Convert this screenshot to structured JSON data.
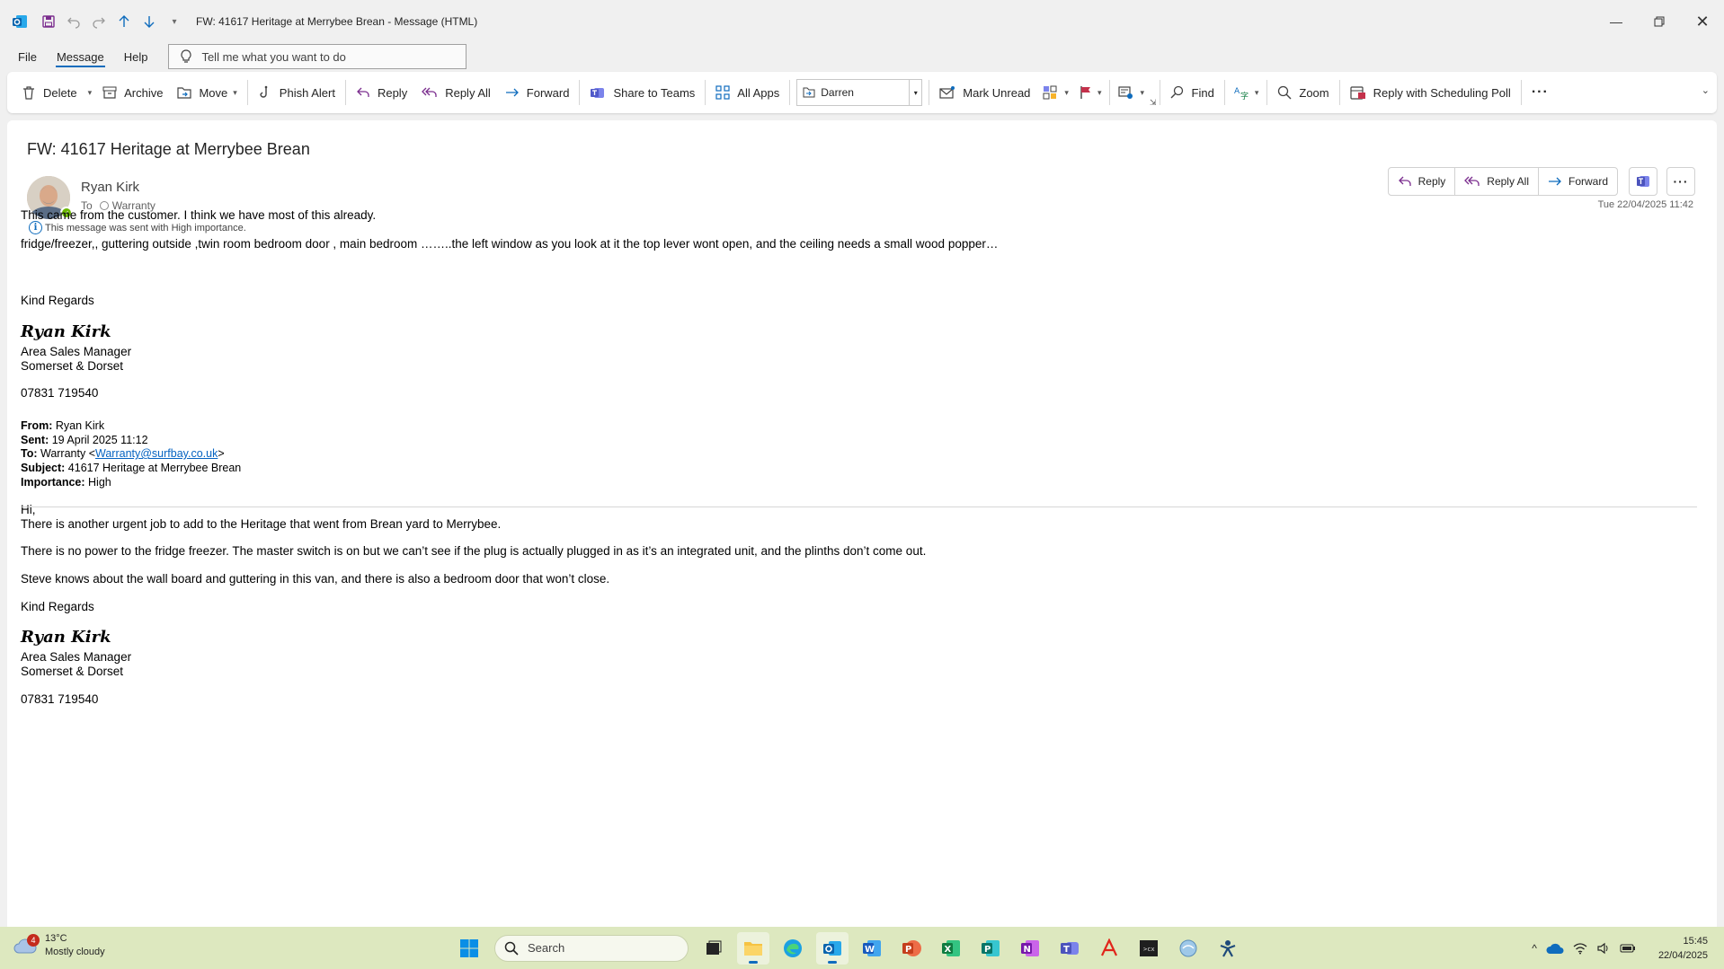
{
  "window": {
    "title": "FW: 41617 Heritage at Merrybee Brean  -  Message (HTML)"
  },
  "menu": {
    "tabs": [
      "File",
      "Message",
      "Help"
    ],
    "active_tab": "Message",
    "tell_me_placeholder": "Tell me what you want to do"
  },
  "ribbon": {
    "delete": "Delete",
    "archive": "Archive",
    "move": "Move",
    "phish_alert": "Phish Alert",
    "reply": "Reply",
    "reply_all": "Reply All",
    "forward": "Forward",
    "share_to_teams": "Share to Teams",
    "all_apps": "All Apps",
    "quick_step_value": "Darren",
    "mark_unread": "Mark Unread",
    "find": "Find",
    "zoom": "Zoom",
    "reply_scheduling_poll": "Reply with Scheduling Poll"
  },
  "message": {
    "subject": "FW: 41617 Heritage at Merrybee Brean",
    "sender": "Ryan Kirk",
    "to_label": "To",
    "to": "Warranty",
    "importance_notice": "This message was sent with High importance.",
    "datetime": "Tue 22/04/2025 11:42",
    "actions": {
      "reply": "Reply",
      "reply_all": "Reply All",
      "forward": "Forward"
    }
  },
  "body": {
    "line1": "This came from the customer. I think we have most of this already.",
    "line2": "fridge/freezer,, guttering outside ,twin room bedroom door , main bedroom ……..the left window as you look at it the top lever wont open, and the ceiling needs a small wood popper…",
    "regards1": "Kind Regards",
    "sig1": {
      "name": "Ryan Kirk",
      "title": "Area Sales Manager",
      "region": "Somerset & Dorset",
      "phone": "07831 719540"
    },
    "forwarded": {
      "from_label": "From:",
      "from": " Ryan Kirk",
      "sent_label": "Sent:",
      "sent": " 19 April 2025 11:12",
      "to_label": "To:",
      "to_name": " Warranty <",
      "to_email": "Warranty@surfbay.co.uk",
      "to_close": ">",
      "subject_label": "Subject:",
      "subject": " 41617 Heritage at Merrybee Brean",
      "importance_label": "Importance:",
      "importance": " High"
    },
    "hi": "Hi,",
    "p1": "There is another urgent job to add to the Heritage that went from Brean yard to Merrybee.",
    "p2": "There is no power to the fridge freezer. The master switch is on but we can’t see if the plug is actually plugged in as it’s an integrated unit, and the plinths don’t come out.",
    "p3": "Steve knows about the wall board and guttering in this van, and there is also a bedroom door that won’t close.",
    "regards2": "Kind Regards",
    "sig2": {
      "name": "Ryan Kirk",
      "title": "Area Sales Manager",
      "region": "Somerset & Dorset",
      "phone": "07831 719540"
    }
  },
  "taskbar": {
    "weather_badge": "4",
    "temperature": "13°C",
    "condition": "Mostly cloudy",
    "search": "Search",
    "time": "15:45",
    "date": "22/04/2025"
  },
  "colors": {
    "accent": "#0f6cbd",
    "taskbar": "#dde8bf",
    "link": "#0563c1"
  }
}
